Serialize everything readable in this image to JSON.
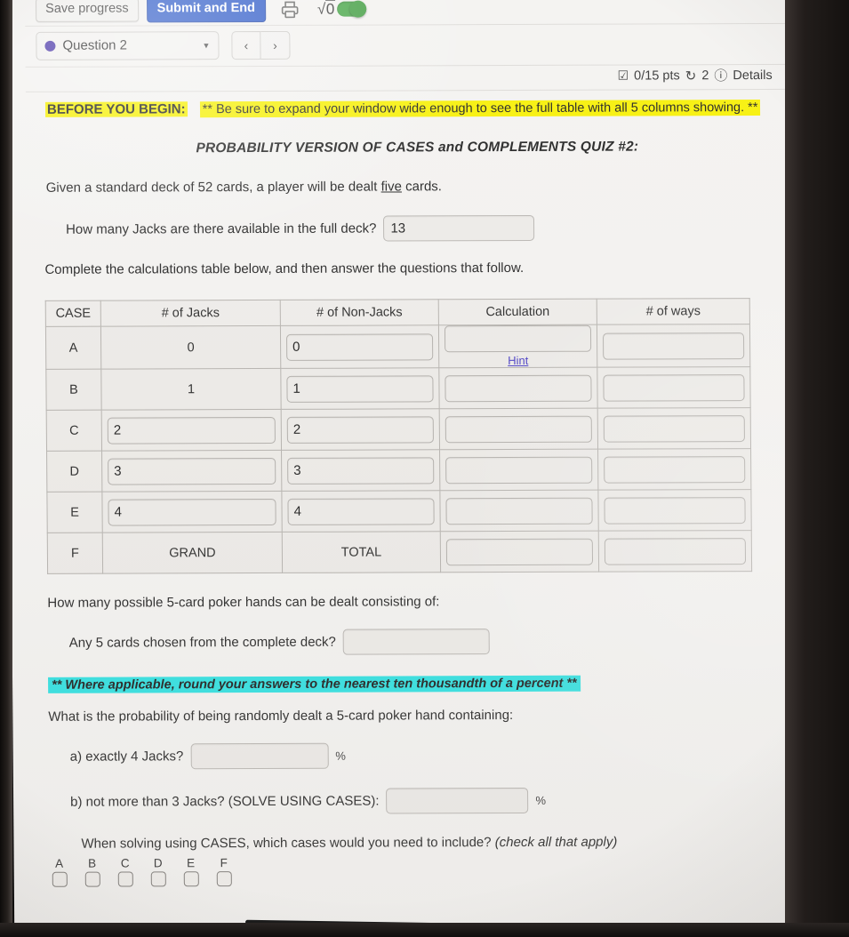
{
  "toolbar": {
    "save_label": "Save progress",
    "submit_label": "Submit and End",
    "print_icon": "printer-icon",
    "math_toggle_glyph": "√0",
    "math_toggle_state": "on",
    "toggle_color": "#45a545",
    "submit_color": "#2b58c7"
  },
  "question_bar": {
    "status_dot_color": "#4a37a8",
    "question_label": "Question 2",
    "caret_icon": "chevron-down-icon",
    "prev_icon": "‹",
    "next_icon": "›"
  },
  "points_row": {
    "checkbox_icon": "checkbox-check-icon",
    "points": "0/15 pts",
    "retry_icon": "retry-icon",
    "retry_count": "2",
    "info_icon": "info-circle-icon",
    "details_label": "Details"
  },
  "intro": {
    "begin_title": "BEFORE YOU BEGIN:",
    "begin_note": "** Be sure to expand your window wide enough to see the full table with all 5 columns showing. **",
    "quiz_title": "PROBABILITY VERSION OF CASES and COMPLEMENTS QUIZ #2:",
    "highlight_yellow": "#f7f000",
    "highlight_cyan": "#2fe0e0"
  },
  "prompt": {
    "given_pre": "Given a standard deck of 52 cards, a player will be dealt ",
    "given_underlined": "five",
    "given_post": " cards.",
    "jacks_question": "How many Jacks are there available in the full deck?",
    "jacks_value": "13",
    "complete_line": "Complete the calculations table below, and then answer the questions that follow."
  },
  "table": {
    "headers": [
      "CASE",
      "# of Jacks",
      "# of Non-Jacks",
      "Calculation",
      "# of ways"
    ],
    "hint_label": "Hint",
    "rows": [
      {
        "case": "A",
        "jacks": "0",
        "jacks_type": "static",
        "nonjacks": "0",
        "nonjacks_type": "input",
        "calculation": "",
        "calculation_type": "input",
        "has_hint": true,
        "ways": "",
        "ways_type": "input"
      },
      {
        "case": "B",
        "jacks": "1",
        "jacks_type": "static",
        "nonjacks": "1",
        "nonjacks_type": "input",
        "calculation": "",
        "calculation_type": "input",
        "has_hint": false,
        "ways": "",
        "ways_type": "input"
      },
      {
        "case": "C",
        "jacks": "2",
        "jacks_type": "input",
        "nonjacks": "2",
        "nonjacks_type": "input",
        "calculation": "",
        "calculation_type": "input",
        "has_hint": false,
        "ways": "",
        "ways_type": "input"
      },
      {
        "case": "D",
        "jacks": "3",
        "jacks_type": "input",
        "nonjacks": "3",
        "nonjacks_type": "input",
        "calculation": "",
        "calculation_type": "input",
        "has_hint": false,
        "ways": "",
        "ways_type": "input"
      },
      {
        "case": "E",
        "jacks": "4",
        "jacks_type": "input",
        "nonjacks": "4",
        "nonjacks_type": "input",
        "calculation": "",
        "calculation_type": "input",
        "has_hint": false,
        "ways": "",
        "ways_type": "input"
      },
      {
        "case": "F",
        "jacks": "GRAND",
        "jacks_type": "static",
        "nonjacks": "TOTAL",
        "nonjacks_type": "static",
        "calculation": "",
        "calculation_type": "input",
        "has_hint": false,
        "ways": "",
        "ways_type": "input"
      }
    ]
  },
  "lower": {
    "hands_question": "How many possible 5-card poker hands can be dealt consisting of:",
    "any5_label": "Any 5 cards chosen from the complete deck?",
    "any5_value": "",
    "round_note": "** Where applicable, round your answers to the nearest ten thousandth of a percent **",
    "probability_question": "What is the probability of being randomly dealt a 5-card poker hand containing:",
    "a_label": "a) exactly 4 Jacks?",
    "a_value": "",
    "a_suffix": "%",
    "b_label": "b) not more than 3 Jacks? (SOLVE USING CASES):",
    "b_value": "",
    "b_suffix": "%",
    "cases_prompt_bold": "When solving using CASES, which cases would you need to include? ",
    "cases_prompt_italic": "(check all that apply)",
    "case_options": [
      {
        "label": "A",
        "checked": false
      },
      {
        "label": "B",
        "checked": false
      },
      {
        "label": "C",
        "checked": false
      },
      {
        "label": "D",
        "checked": false
      },
      {
        "label": "E",
        "checked": false
      },
      {
        "label": "F",
        "checked": false
      }
    ]
  }
}
